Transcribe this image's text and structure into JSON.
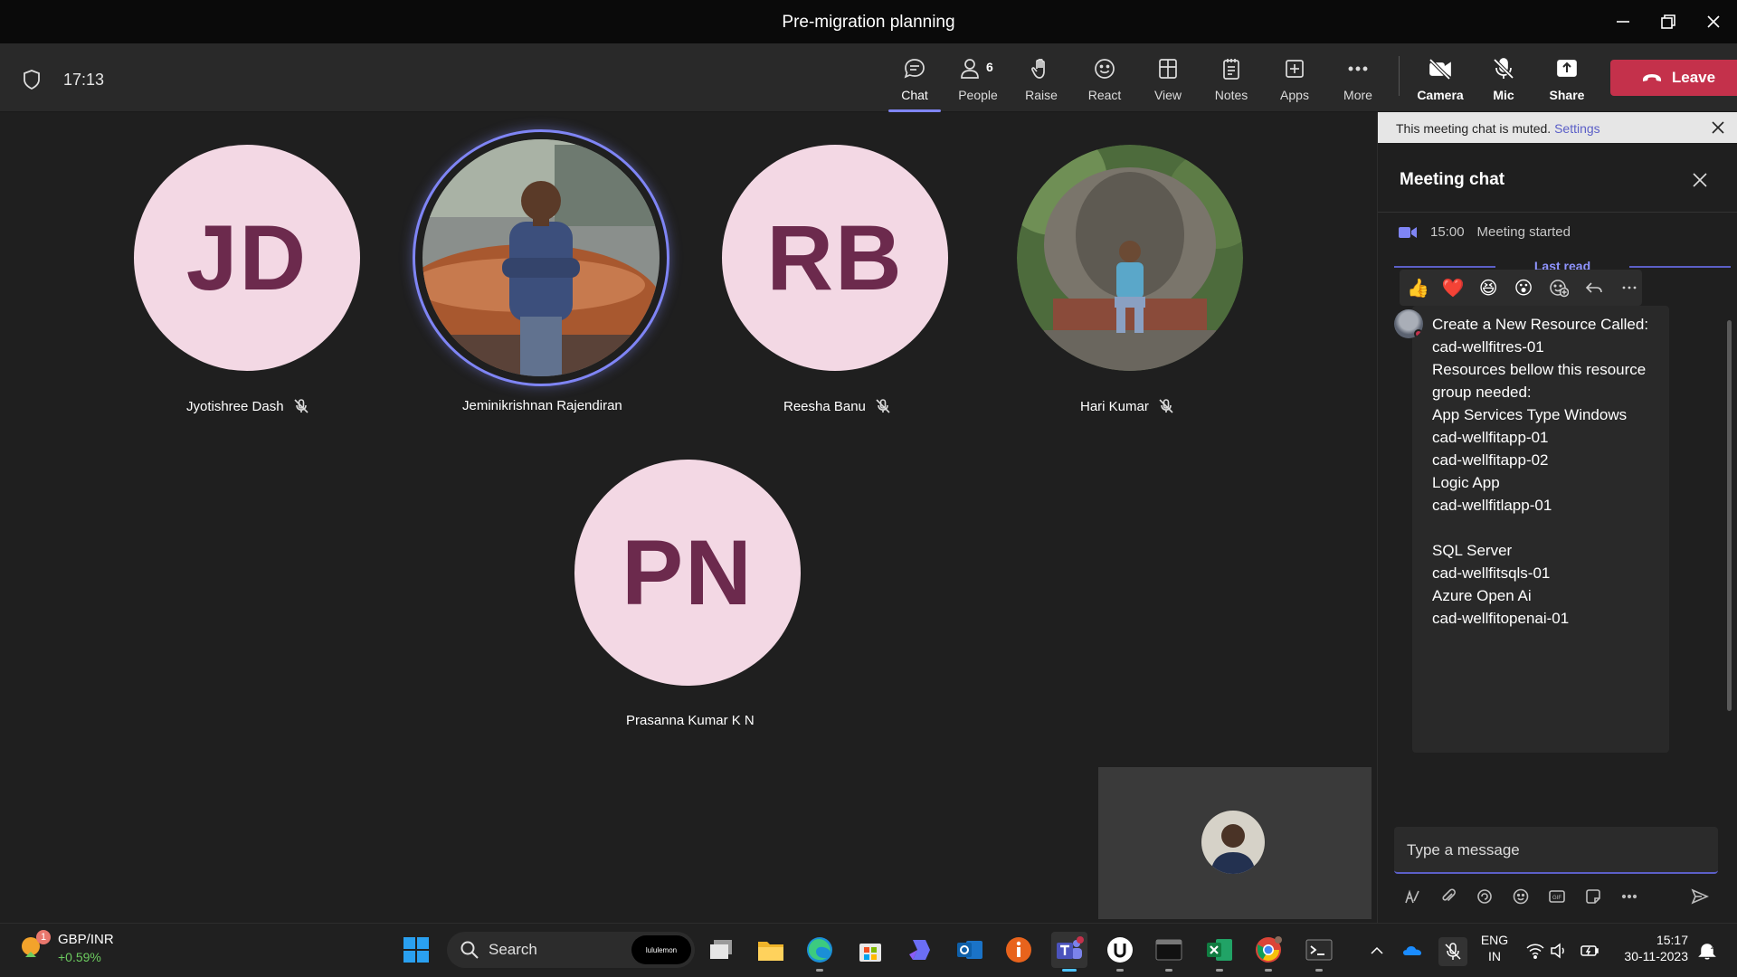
{
  "window": {
    "title": "Pre-migration planning"
  },
  "toolbar": {
    "timer": "17:13",
    "buttons": [
      {
        "id": "chat",
        "label": "Chat",
        "icon": "chat-icon"
      },
      {
        "id": "people",
        "label": "People",
        "icon": "people-icon",
        "count": "6"
      },
      {
        "id": "raise",
        "label": "Raise",
        "icon": "raise-hand-icon"
      },
      {
        "id": "react",
        "label": "React",
        "icon": "smiley-icon"
      },
      {
        "id": "view",
        "label": "View",
        "icon": "view-layout-icon"
      },
      {
        "id": "notes",
        "label": "Notes",
        "icon": "notes-icon"
      },
      {
        "id": "apps",
        "label": "Apps",
        "icon": "add-apps-icon"
      },
      {
        "id": "more",
        "label": "More",
        "icon": "more-ellipsis-icon"
      },
      {
        "id": "camera",
        "label": "Camera",
        "icon": "camera-off-icon"
      },
      {
        "id": "mic",
        "label": "Mic",
        "icon": "mic-off-icon"
      },
      {
        "id": "share",
        "label": "Share",
        "icon": "share-screen-icon"
      }
    ],
    "leave_label": "Leave"
  },
  "participants": [
    {
      "name": "Jyotishree Dash",
      "initials": "JD",
      "muted": true
    },
    {
      "name": "Jeminikrishnan Rajendiran",
      "initials": "",
      "muted": false,
      "speaking": true
    },
    {
      "name": "Reesha Banu",
      "initials": "RB",
      "muted": true
    },
    {
      "name": "Hari Kumar",
      "initials": "",
      "muted": true
    },
    {
      "name": "Prasanna Kumar K N",
      "initials": "PN",
      "muted": false
    }
  ],
  "chat": {
    "muted_notice": "This meeting chat is muted.",
    "muted_link": "Settings",
    "header": "Meeting chat",
    "system_time": "15:00",
    "system_text": "Meeting started",
    "last_read": "Last read",
    "reactions": [
      "👍",
      "❤️",
      "😆",
      "😮"
    ],
    "message_lines": [
      "Create a New Resource Called:",
      "cad-wellfitres-01",
      "Resources bellow this resource",
      "group needed:",
      "App Services Type Windows",
      "cad-wellfitapp-01",
      "cad-wellfitapp-02",
      "Logic App",
      "cad-wellfitlapp-01",
      "",
      "SQL Server",
      "cad-wellfitsqls-01",
      "Azure Open Ai",
      "cad-wellfitopenai-01"
    ],
    "compose_placeholder": "Type a message"
  },
  "taskbar": {
    "stock_pair": "GBP/INR",
    "stock_change": "+0.59%",
    "stock_badge": "1",
    "search_label": "Search",
    "search_promo": "lululemon",
    "language": "ENG",
    "region": "IN",
    "time": "15:17",
    "date": "30-11-2023"
  },
  "colors": {
    "accent": "#7f85f5",
    "leave": "#c4314b",
    "avatar_bg": "#f3d8e4",
    "avatar_text": "#6c2a4d"
  }
}
